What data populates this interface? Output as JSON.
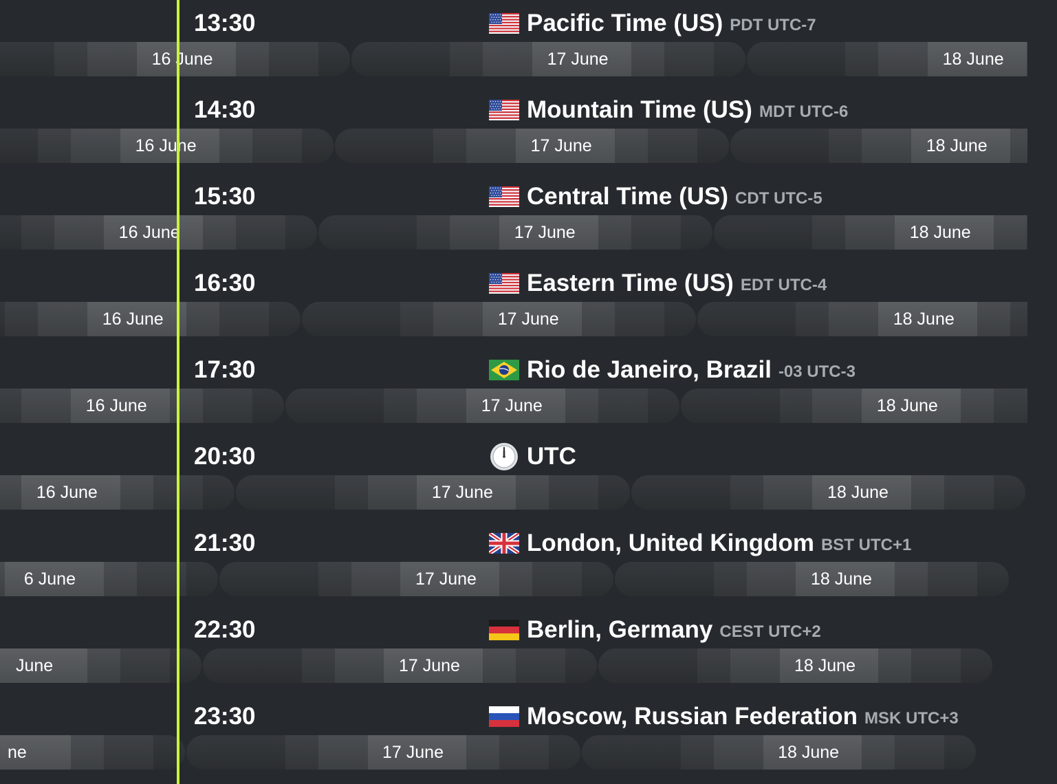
{
  "accent_color": "#c8f43c",
  "rows": [
    {
      "time": "13:30",
      "flag": "flag-us-icon",
      "name": "Pacific Time (US)",
      "abbr": "PDT UTC-7",
      "days": [
        "16 June",
        "17 June",
        "18 June"
      ]
    },
    {
      "time": "14:30",
      "flag": "flag-us-icon",
      "name": "Mountain Time (US)",
      "abbr": "MDT UTC-6",
      "days": [
        "16 June",
        "17 June",
        "18 June"
      ]
    },
    {
      "time": "15:30",
      "flag": "flag-us-icon",
      "name": "Central Time (US)",
      "abbr": "CDT UTC-5",
      "days": [
        "16 June",
        "17 June",
        "18 June"
      ]
    },
    {
      "time": "16:30",
      "flag": "flag-us-icon",
      "name": "Eastern Time (US)",
      "abbr": "EDT UTC-4",
      "days": [
        "16 June",
        "17 June",
        "18 June"
      ]
    },
    {
      "time": "17:30",
      "flag": "flag-brazil-icon",
      "name": "Rio de Janeiro, Brazil",
      "abbr": "-03 UTC-3",
      "days": [
        "16 June",
        "17 June",
        "18 June"
      ]
    },
    {
      "time": "20:30",
      "flag": "clock-icon",
      "name": "UTC",
      "abbr": "",
      "days": [
        "16 June",
        "17 June",
        "18 June"
      ]
    },
    {
      "time": "21:30",
      "flag": "flag-uk-icon",
      "name": "London, United Kingdom",
      "abbr": "BST UTC+1",
      "days": [
        "6 June",
        "17 June",
        "18 June"
      ]
    },
    {
      "time": "22:30",
      "flag": "flag-germany-icon",
      "name": "Berlin, Germany",
      "abbr": "CEST UTC+2",
      "days": [
        "June",
        "17 June",
        "18 June"
      ]
    },
    {
      "time": "23:30",
      "flag": "flag-russia-icon",
      "name": "Moscow, Russian Federation",
      "abbr": "MSK UTC+3",
      "days": [
        "ne",
        "17 June",
        "18 June"
      ]
    }
  ]
}
